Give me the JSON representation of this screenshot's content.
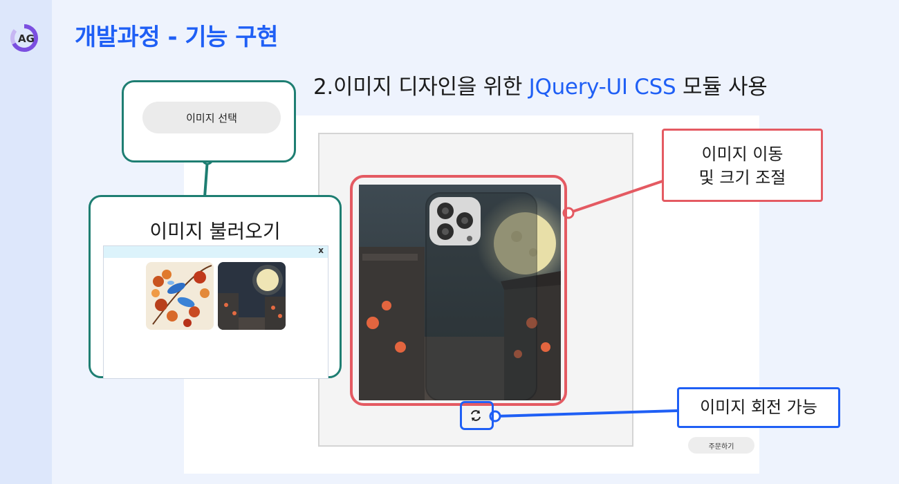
{
  "header": {
    "title": "개발과정 - 기능 구현"
  },
  "subtitle": {
    "prefix": "2.이미지 디자인을 위한 ",
    "highlight": "JQuery-UI CSS",
    "suffix": " 모듈 사용"
  },
  "callouts": {
    "select_button_label": "이미지 선택",
    "load_label": "이미지 불러오기",
    "dialog_close": "x",
    "move_resize_line1": "이미지 이동",
    "move_resize_line2": "및 크기 조절",
    "rotate": "이미지 회전 가능"
  },
  "order_button": "주문하기",
  "colors": {
    "accent_blue": "#1f5ff5",
    "callout_green": "#1e7e72",
    "callout_red": "#e45a62"
  },
  "icons": {
    "logo": "ag-logo-icon",
    "rotate": "rotate-arrows-icon",
    "close": "close-icon"
  }
}
